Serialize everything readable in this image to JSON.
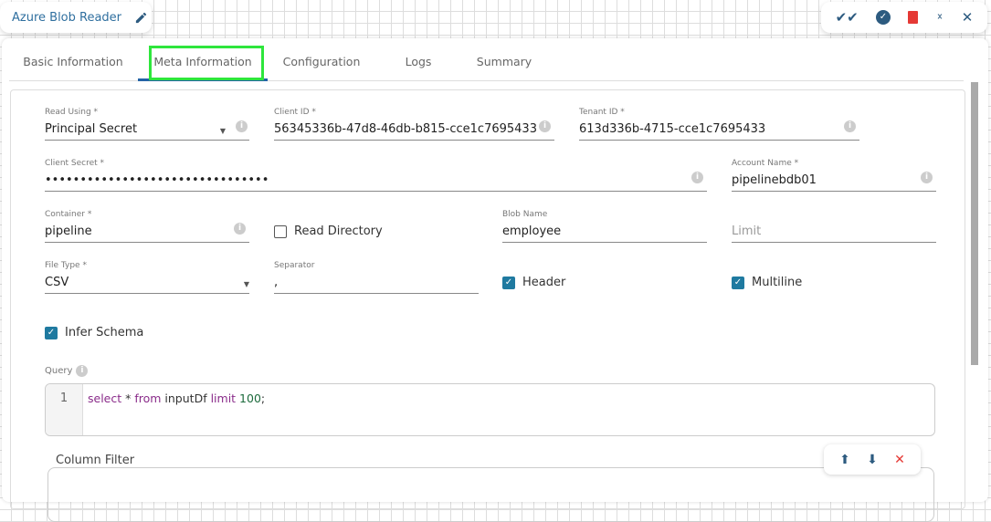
{
  "header": {
    "title": "Azure Blob Reader"
  },
  "tabs": [
    "Basic Information",
    "Meta Information",
    "Configuration",
    "Logs",
    "Summary"
  ],
  "form": {
    "read_using": {
      "label": "Read Using *",
      "value": "Principal Secret"
    },
    "client_id": {
      "label": "Client ID *",
      "value": "56345336b-47d8-46db-b815-cce1c7695433"
    },
    "tenant_id": {
      "label": "Tenant ID *",
      "value": "613d336b-4715-cce1c7695433"
    },
    "client_secret": {
      "label": "Client Secret *",
      "value": "••••••••••••••••••••••••••••••••"
    },
    "account_name": {
      "label": "Account Name *",
      "value": "pipelinebdb01"
    },
    "container": {
      "label": "Container *",
      "value": "pipeline"
    },
    "read_directory": {
      "label": "Read Directory",
      "checked": false
    },
    "blob_name": {
      "label": "Blob Name",
      "value": "employee"
    },
    "limit": {
      "placeholder": "Limit"
    },
    "file_type": {
      "label": "File Type *",
      "value": "CSV"
    },
    "separator": {
      "label": "Separator",
      "value": ","
    },
    "header": {
      "label": "Header",
      "checked": true
    },
    "multiline": {
      "label": "Multiline",
      "checked": true
    },
    "infer_schema": {
      "label": "Infer Schema",
      "checked": true
    },
    "query": {
      "label": "Query",
      "line": "1",
      "kw1": "select",
      "t1": " * ",
      "kw2": "from",
      "t2": " inputDf ",
      "kw3": "limit",
      "num": " 100",
      "t3": ";"
    },
    "column_filter": {
      "label": "Column Filter"
    }
  },
  "icons": {
    "info": "i",
    "check": "✓",
    "caret": "▼"
  }
}
